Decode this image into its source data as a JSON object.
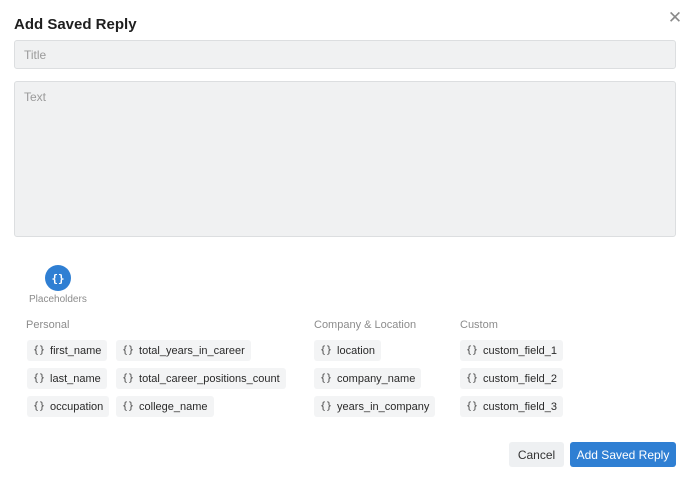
{
  "dialog": {
    "title": "Add Saved Reply",
    "close_icon": "close-icon"
  },
  "form": {
    "title_placeholder": "Title",
    "title_value": "",
    "text_placeholder": "Text",
    "text_value": ""
  },
  "placeholders": {
    "icon": "curly-braces-icon",
    "icon_glyph": "{}",
    "label": "Placeholders",
    "chip_prefix": "{}",
    "groups": [
      {
        "heading": "Personal",
        "items": [
          "first_name",
          "last_name",
          "occupation",
          "total_years_in_career",
          "total_career_positions_count",
          "college_name"
        ]
      },
      {
        "heading": "Company & Location",
        "items": [
          "location",
          "company_name",
          "years_in_company"
        ]
      },
      {
        "heading": "Custom",
        "items": [
          "custom_field_1",
          "custom_field_2",
          "custom_field_3"
        ]
      }
    ]
  },
  "actions": {
    "cancel_label": "Cancel",
    "save_label": "Add Saved Reply"
  },
  "colors": {
    "accent": "#2f7fd3",
    "field_bg": "#f0f1f2",
    "chip_bg": "#f3f4f5"
  }
}
